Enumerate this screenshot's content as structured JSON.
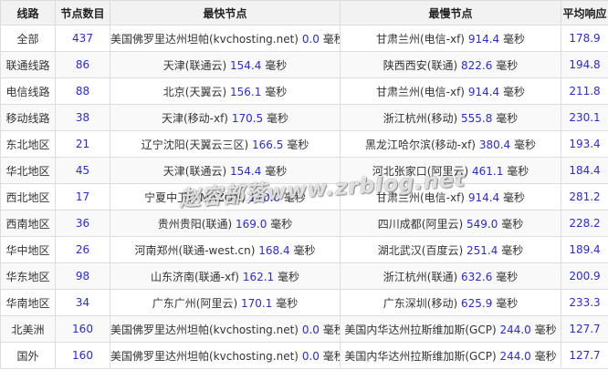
{
  "headers": {
    "route": "线路",
    "count": "节点数目",
    "fastest": "最快节点",
    "slowest": "最慢节点",
    "average": "平均响应"
  },
  "unit": "毫秒",
  "rows": [
    {
      "route": "全部",
      "count": "437",
      "fast_name": "美国佛罗里达州坦帕(kvchosting.net)",
      "fast_ms": "0.0",
      "slow_name": "甘肃兰州(电信-xf)",
      "slow_ms": "914.4",
      "avg_ms": "178.9"
    },
    {
      "route": "联通线路",
      "count": "86",
      "fast_name": "天津(联通云)",
      "fast_ms": "154.4",
      "slow_name": "陕西西安(联通)",
      "slow_ms": "822.6",
      "avg_ms": "194.8"
    },
    {
      "route": "电信线路",
      "count": "88",
      "fast_name": "北京(天翼云)",
      "fast_ms": "156.1",
      "slow_name": "甘肃兰州(电信-xf)",
      "slow_ms": "914.4",
      "avg_ms": "211.8"
    },
    {
      "route": "移动线路",
      "count": "38",
      "fast_name": "天津(移动-xf)",
      "fast_ms": "170.5",
      "slow_name": "浙江杭州(移动)",
      "slow_ms": "555.8",
      "avg_ms": "230.1"
    },
    {
      "route": "东北地区",
      "count": "21",
      "fast_name": "辽宁沈阳(天翼云三区)",
      "fast_ms": "166.5",
      "slow_name": "黑龙江哈尔滨(移动-xf)",
      "slow_ms": "380.4",
      "avg_ms": "193.4"
    },
    {
      "route": "华北地区",
      "count": "45",
      "fast_name": "天津(联通云)",
      "fast_ms": "154.4",
      "slow_name": "河北张家口(阿里云)",
      "slow_ms": "461.1",
      "avg_ms": "184.4"
    },
    {
      "route": "西北地区",
      "count": "17",
      "fast_name": "宁夏中卫(AMAZON)",
      "fast_ms": "170.0",
      "slow_name": "甘肃兰州(电信-xf)",
      "slow_ms": "914.4",
      "avg_ms": "281.2"
    },
    {
      "route": "西南地区",
      "count": "36",
      "fast_name": "贵州贵阳(联通)",
      "fast_ms": "169.0",
      "slow_name": "四川成都(阿里云)",
      "slow_ms": "549.0",
      "avg_ms": "228.2"
    },
    {
      "route": "华中地区",
      "count": "26",
      "fast_name": "河南郑州(联通-west.cn)",
      "fast_ms": "168.4",
      "slow_name": "湖北武汉(百度云)",
      "slow_ms": "251.4",
      "avg_ms": "189.4"
    },
    {
      "route": "华东地区",
      "count": "98",
      "fast_name": "山东济南(联通-xf)",
      "fast_ms": "162.1",
      "slow_name": "浙江杭州(联通)",
      "slow_ms": "632.6",
      "avg_ms": "200.9"
    },
    {
      "route": "华南地区",
      "count": "34",
      "fast_name": "广东广州(阿里云)",
      "fast_ms": "170.1",
      "slow_name": "广东深圳(移动)",
      "slow_ms": "625.9",
      "avg_ms": "233.3"
    },
    {
      "route": "北美洲",
      "count": "160",
      "fast_name": "美国佛罗里达州坦帕(kvchosting.net)",
      "fast_ms": "0.0",
      "slow_name": "美国内华达州拉斯维加斯(GCP)",
      "slow_ms": "244.0",
      "avg_ms": "127.7"
    },
    {
      "route": "国外",
      "count": "160",
      "fast_name": "美国佛罗里达州坦帕(kvchosting.net)",
      "fast_ms": "0.0",
      "slow_name": "美国内华达州拉斯维加斯(GCP)",
      "slow_ms": "244.0",
      "avg_ms": "127.7"
    }
  ],
  "watermark": "赵容部落www.zrblog.net",
  "colors": {
    "number": "#2a2ad6",
    "header_bg": "#f2f2f2",
    "border": "#dddddd"
  }
}
